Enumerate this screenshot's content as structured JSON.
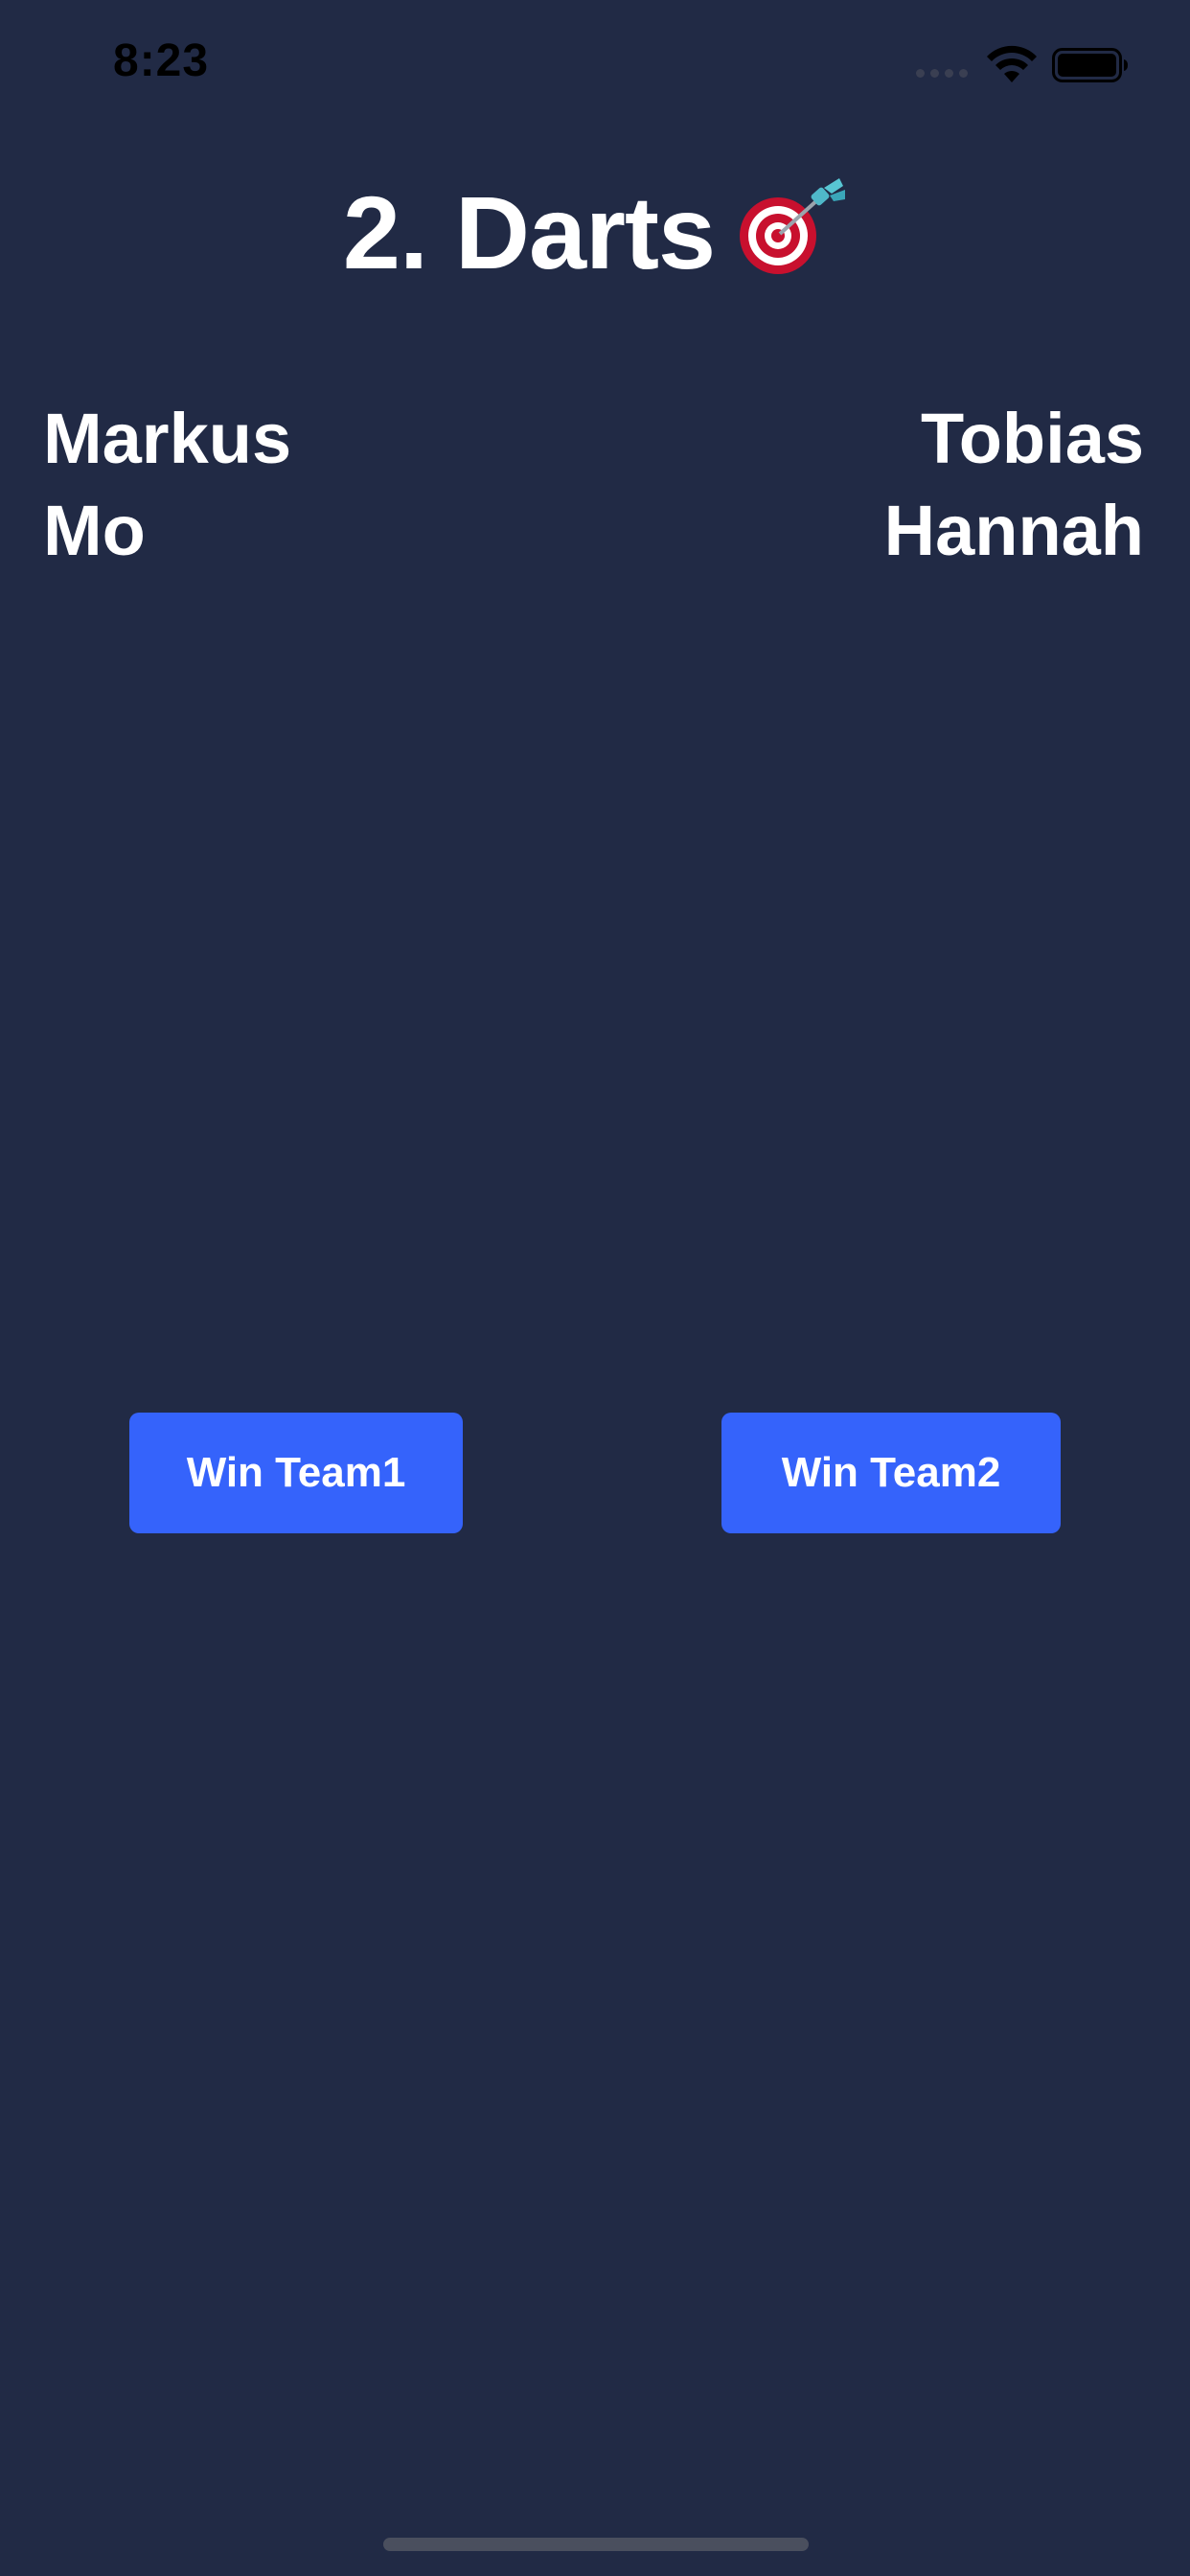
{
  "status_bar": {
    "time": "8:23",
    "icons": [
      "cellular-signal-icon",
      "wifi-icon",
      "battery-icon"
    ]
  },
  "title": {
    "text": "2. Darts",
    "emoji_icon": "dart-target-icon"
  },
  "team1": {
    "players": [
      "Markus",
      "Mo"
    ]
  },
  "team2": {
    "players": [
      "Tobias",
      "Hannah"
    ]
  },
  "buttons": {
    "win_team1": "Win Team1",
    "win_team2": "Win Team2"
  },
  "colors": {
    "background": "#212a45",
    "accent": "#3563fb",
    "text": "#ffffff"
  }
}
